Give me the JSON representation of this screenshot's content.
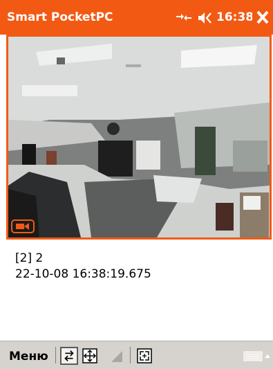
{
  "titlebar": {
    "title": "Smart PocketPC",
    "time": "16:38",
    "icons": [
      "connectivity-icon",
      "volume-icon",
      "close-icon"
    ],
    "accent_color": "#f25a14"
  },
  "video": {
    "content": "camera-feed-office",
    "indicator_icon": "video-camera-icon"
  },
  "info": {
    "channel": "[2] 2",
    "timestamp": "22-10-08 16:38:19.675"
  },
  "toolbar": {
    "menu_label": "Меню",
    "icons": [
      "swap-arrows-icon",
      "fit-window-icon",
      "ptz-triangle-icon",
      "fullscreen-icon",
      "keyboard-icon"
    ]
  }
}
